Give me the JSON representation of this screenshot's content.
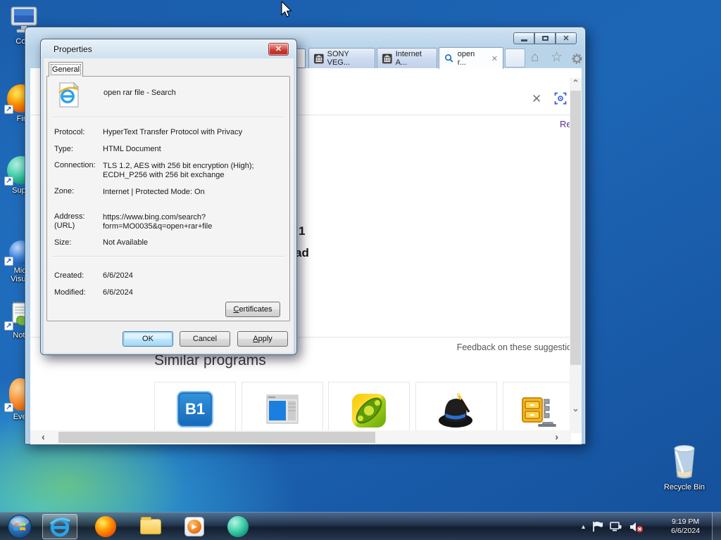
{
  "desktop": {
    "icons": [
      {
        "label": "Com"
      },
      {
        "label": "Fir"
      },
      {
        "label": "Supe"
      },
      {
        "label": "Micr\nVisual"
      },
      {
        "label": "Note"
      },
      {
        "label": "Ever"
      },
      {
        "label": "Recycle Bin"
      }
    ]
  },
  "browser": {
    "tabs": [
      {
        "label": "SONY VEG..."
      },
      {
        "label": "Internet A..."
      },
      {
        "label": "open r...",
        "close": "✕"
      }
    ],
    "controls": {
      "close_glyph": "✕"
    },
    "page": {
      "clear_glyph": "✕",
      "remove_link": "Rem",
      "fragment_top": "1",
      "fragment_bottom": "ad",
      "feedback": "Feedback on these suggestio",
      "similar_heading": "Similar programs",
      "b1_label": "B1"
    },
    "scroll": {
      "up": "⌃",
      "down": "⌄",
      "left": "‹",
      "right": "›"
    }
  },
  "dialog": {
    "title": "Properties",
    "close_glyph": "✕",
    "tab_general": "General",
    "doc_title": "open rar file - Search",
    "fields": {
      "protocol": {
        "label": "Protocol:",
        "value": "HyperText Transfer Protocol with Privacy"
      },
      "type": {
        "label": "Type:",
        "value": "HTML Document"
      },
      "connection": {
        "label": "Connection:",
        "value": "TLS 1.2, AES with 256 bit encryption (High);\nECDH_P256 with 256 bit exchange"
      },
      "zone": {
        "label": "Zone:",
        "value": "Internet | Protected Mode: On"
      },
      "address": {
        "label": "Address:\n(URL)",
        "value": "https://www.bing.com/search?\nform=MO0035&q=open+rar+file"
      },
      "size": {
        "label": "Size:",
        "value": "Not Available"
      },
      "created": {
        "label": "Created:",
        "value": "6/6/2024"
      },
      "modified": {
        "label": "Modified:",
        "value": "6/6/2024"
      }
    },
    "buttons": {
      "certificates_initial": "C",
      "certificates_rest": "ertificates",
      "ok": "OK",
      "cancel": "Cancel",
      "apply_initial": "A",
      "apply_rest": "pply"
    }
  },
  "taskbar": {
    "tray_expand_glyph": "▴",
    "time": "9:19 PM",
    "date": "6/6/2024"
  },
  "colors": {
    "accent_blue": "#2aa3e8",
    "default_button_glow": "#a8d8f0",
    "close_red": "#c83a31",
    "link_purple": "#5b2d90"
  }
}
